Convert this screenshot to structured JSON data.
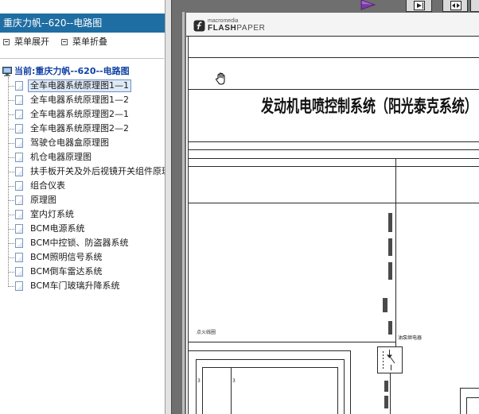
{
  "sidebar": {
    "title": "重庆力帆--620--电路图",
    "menu": {
      "expand_label": "菜单展开",
      "collapse_label": "菜单折叠"
    },
    "tree": {
      "root_label": "当前:重庆力帆--620--电路图",
      "selected_index": 0,
      "items": [
        {
          "label": "全车电器系统原理图1—1"
        },
        {
          "label": "全车电器系统原理图1—2"
        },
        {
          "label": "全车电器系统原理图2—1"
        },
        {
          "label": "全车电器系统原理图2—2"
        },
        {
          "label": "驾驶仓电器盒原理图"
        },
        {
          "label": "机仓电器原理图"
        },
        {
          "label": "扶手板开关及外后视镜开关组件原理"
        },
        {
          "label": "组合仪表"
        },
        {
          "label": "原理图"
        },
        {
          "label": "室内灯系统"
        },
        {
          "label": "BCM电源系统"
        },
        {
          "label": "BCM中控锁、防盗器系统"
        },
        {
          "label": "BCM照明信号系统"
        },
        {
          "label": "BCM倒车雷达系统"
        },
        {
          "label": "BCM车门玻璃升降系统"
        }
      ]
    }
  },
  "viewer": {
    "logo": {
      "brand": "macromedia",
      "product_bold": "FLASH",
      "product_light": "PAPER"
    },
    "document": {
      "title": "发动机电喷控制系统（阳光泰克系统）",
      "labels": {
        "left_component": "点火线圈",
        "relay": "油泵继电器",
        "pin_a": "3",
        "pin_b": "3"
      }
    }
  },
  "icons": {
    "menu_expand": "expand-box-icon",
    "menu_collapse": "collapse-box-icon",
    "tree_root": "computer-icon",
    "tree_item": "document-icon",
    "next_page": "next-page-arrow-icon",
    "toolbar_1": "fit-width-icon",
    "toolbar_2": "fit-page-icon",
    "cursor": "hand-cursor-icon",
    "logo": "flashpaper-logo-icon"
  },
  "colors": {
    "title_bar": "#1f6ea3",
    "root_label": "#1041a5",
    "selected_item_background": "#dfe9f7",
    "viewer_background": "#6f6f6f",
    "next_page_arrow": "#7a3aa8"
  }
}
